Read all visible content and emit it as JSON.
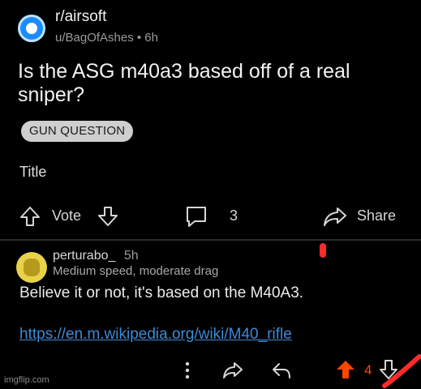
{
  "post": {
    "subreddit": "r/airsoft",
    "meta": "u/BagOfAshes • 6h",
    "title": "Is the ASG m40a3 based off of a real sniper?",
    "flair": "GUN QUESTION",
    "body": "Title"
  },
  "actions": {
    "vote_label": "Vote",
    "comments_count": "3",
    "share_label": "Share"
  },
  "comment": {
    "username": "perturabo_",
    "time": "5h",
    "user_flair": "Medium speed, moderate drag",
    "body": "Believe it or not, it's based on the M40A3.",
    "link": "https://en.m.wikipedia.org/wiki/M40_rifle",
    "score": "4"
  },
  "colors": {
    "background": "#000000",
    "link": "#3d8ad6",
    "upvote_active": "#ff4500",
    "annotation_red": "#ff2b2b"
  },
  "icons": [
    "subreddit-icon",
    "upvote-icon",
    "downvote-icon",
    "comment-icon",
    "share-icon",
    "more-icon",
    "reply-icon",
    "avatar"
  ],
  "watermark": "imgflip.com"
}
